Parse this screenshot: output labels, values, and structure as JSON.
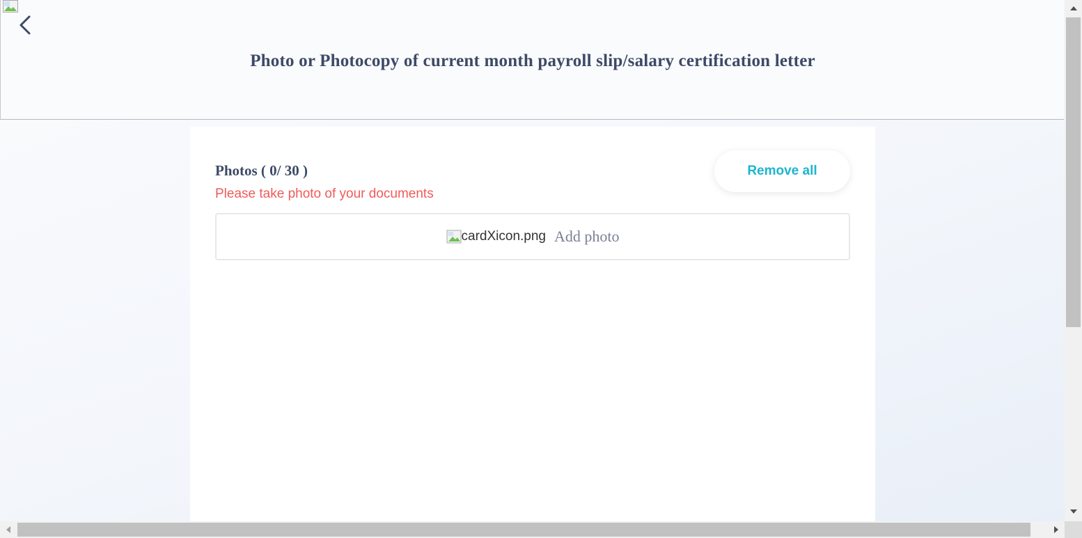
{
  "header": {
    "title": "Photo or Photocopy of current month payroll slip/salary certification letter",
    "back_icon": "chevron-left-icon",
    "broken_image_icon": "broken-image-icon"
  },
  "photos": {
    "heading": "Photos ( 0/ 30 )",
    "hint": "Please take photo of your documents",
    "remove_all_label": "Remove all",
    "add_photo_label": "Add photo",
    "card_icon_alt": "cardXicon.png"
  },
  "colors": {
    "title": "#3d4a66",
    "hint": "#f05a5a",
    "accent": "#1cb5cf",
    "add_label": "#7a8195"
  }
}
